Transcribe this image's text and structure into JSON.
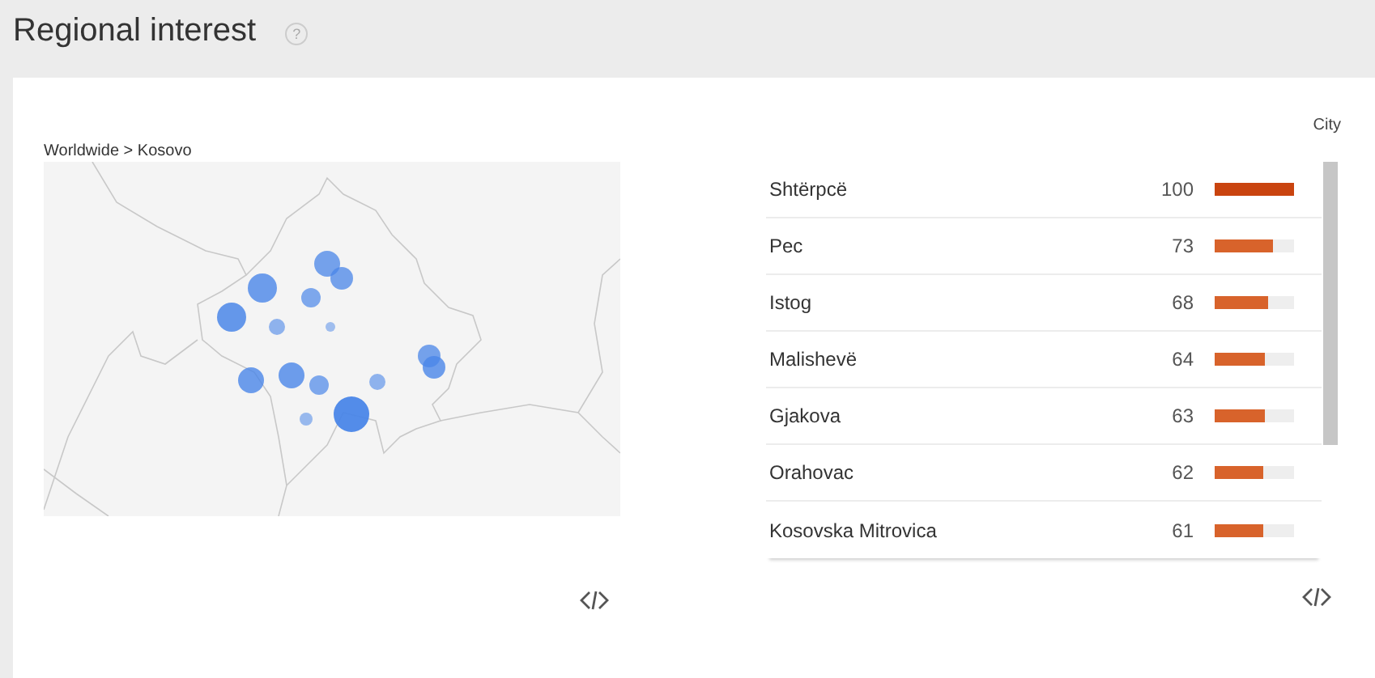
{
  "header": {
    "title": "Regional interest",
    "help_icon": "?"
  },
  "map_panel": {
    "breadcrumb": "Worldwide > Kosovo"
  },
  "list_panel": {
    "column_label": "City",
    "rows": [
      {
        "name": "Shtërpcë",
        "value": "100",
        "level": 1.0,
        "color": "#c9440f"
      },
      {
        "name": "Pec",
        "value": "73",
        "level": 0.73,
        "color": "#d8632b"
      },
      {
        "name": "Istog",
        "value": "68",
        "level": 0.68,
        "color": "#d8632b"
      },
      {
        "name": "Malishevë",
        "value": "64",
        "level": 0.64,
        "color": "#d8632b"
      },
      {
        "name": "Gjakova",
        "value": "63",
        "level": 0.63,
        "color": "#d8632b"
      },
      {
        "name": "Orahovac",
        "value": "62",
        "level": 0.62,
        "color": "#d8632b"
      },
      {
        "name": "Kosovska Mitrovica",
        "value": "61",
        "level": 0.61,
        "color": "#d8632b"
      }
    ]
  }
}
